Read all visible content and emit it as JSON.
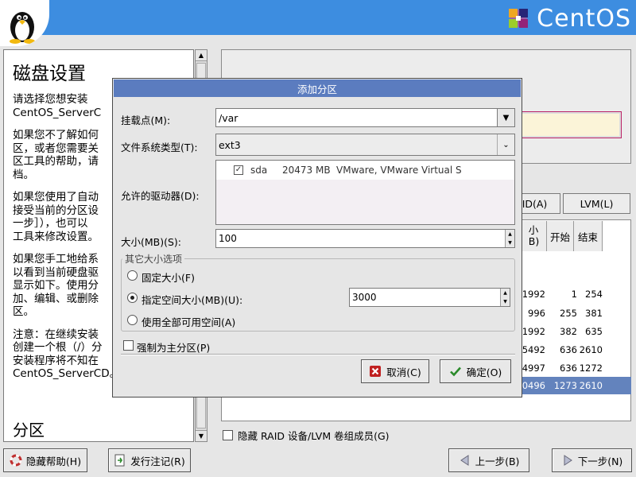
{
  "header": {
    "brand": "CentOS"
  },
  "help": {
    "title": "磁盘设置",
    "paragraphs": [
      "请选择您想安装\nCentOS_ServerC",
      "如果您不了解如何\n区，或者您需要关\n区工具的帮助，请\n档。",
      "如果您使用了自动\n接受当前的分区设\n一步］），也可以\n工具来修改设置。",
      "如果您手工地给系\n以看到当前硬盘驱\n显示如下。使用分\n加、编辑、或删除\n区。",
      "注意：在继续安装\n创建一个根（/）分\n安装程序将不知在\nCentOS_ServerCD。"
    ],
    "bottom_heading": "分区"
  },
  "background": {
    "raid_button": "ID(A)",
    "lvm_button": "LVM(L)",
    "columns": [
      "小\nB)",
      "开始",
      "结束"
    ],
    "rows": [
      {
        "size": "1992",
        "start": "1",
        "end": "254",
        "selected": false
      },
      {
        "size": "996",
        "start": "255",
        "end": "381",
        "selected": false
      },
      {
        "size": "1992",
        "start": "382",
        "end": "635",
        "selected": false
      },
      {
        "size": "5492",
        "start": "636",
        "end": "2610",
        "selected": false
      },
      {
        "size": "4997",
        "start": "636",
        "end": "1272",
        "selected": false
      },
      {
        "size": "0496",
        "start": "1273",
        "end": "2610",
        "selected": true
      }
    ],
    "hide_raid_label": "隐藏 RAID 设备/LVM 卷组成员(G)"
  },
  "dialog": {
    "title": "添加分区",
    "mount_label": "挂载点(M):",
    "mount_value": "/var",
    "fstype_label": "文件系统类型(T):",
    "fstype_value": "ext3",
    "drives_label": "允许的驱动器(D):",
    "drive": {
      "checked": true,
      "name": "sda",
      "size": "20473 MB",
      "model": "VMware, VMware Virtual S"
    },
    "size_label": "大小(MB)(S):",
    "size_value": "100",
    "size_options_title": "其它大小选项",
    "options": [
      {
        "label": "固定大小(F)",
        "selected": false
      },
      {
        "label": "指定空间大小(MB)(U):",
        "selected": true
      },
      {
        "label": "使用全部可用空间(A)",
        "selected": false
      }
    ],
    "max_size_value": "3000",
    "force_primary_label": "强制为主分区(P)",
    "cancel_label": "取消(C)",
    "ok_label": "确定(O)"
  },
  "footer": {
    "hide_help": "隐藏帮助(H)",
    "release_notes": "发行注记(R)",
    "back": "上一步(B)",
    "next": "下一步(N)"
  }
}
